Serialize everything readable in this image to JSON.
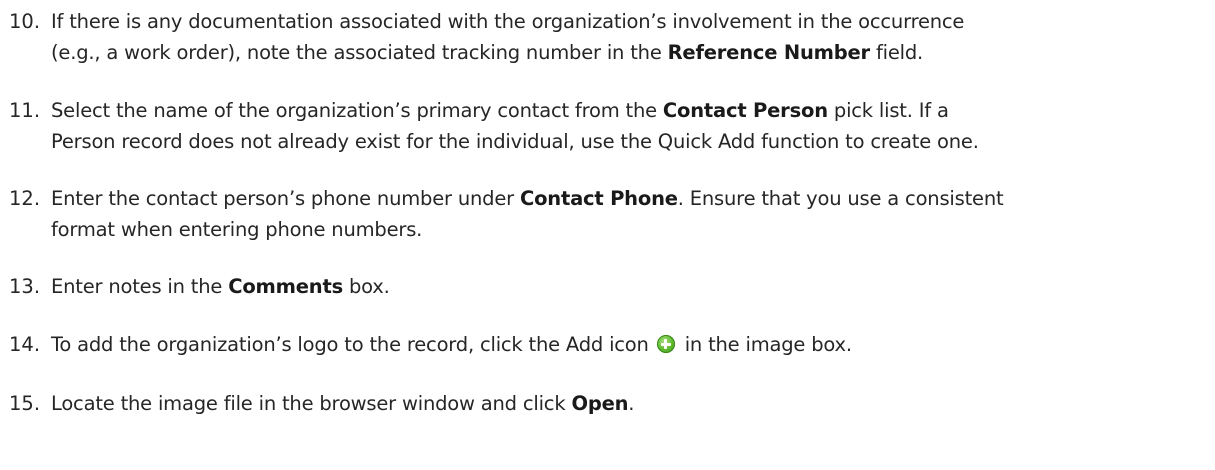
{
  "steps": [
    {
      "number": "10.",
      "lines": [
        [
          "If there is any documentation associated with the organization’s involvement in the occurrence"
        ],
        [
          "(e.g., a work order), note the associated tracking number in the ",
          "Reference Number",
          " field."
        ]
      ]
    },
    {
      "number": "11.",
      "lines": [
        [
          "Select the name of the organization’s primary contact from the ",
          "Contact Person",
          " pick list. If a"
        ],
        [
          "Person record does not already exist for the individual, use the Quick Add function to create one."
        ]
      ]
    },
    {
      "number": "12.",
      "lines": [
        [
          "Enter the contact person’s phone number under ",
          "Contact Phone",
          ". Ensure that you use a consistent"
        ],
        [
          "format when entering phone numbers."
        ]
      ]
    },
    {
      "number": "13.",
      "lines": [
        [
          "Enter notes in the ",
          "Comments",
          " box."
        ]
      ]
    },
    {
      "number": "14.",
      "lines": [
        [
          "To add the organization’s logo to the record, click the Add icon",
          "",
          " in the image box."
        ]
      ],
      "icon": "add-icon"
    },
    {
      "number": "15.",
      "lines": [
        [
          "Locate the image file in the browser window and click ",
          "Open",
          "."
        ]
      ]
    }
  ]
}
